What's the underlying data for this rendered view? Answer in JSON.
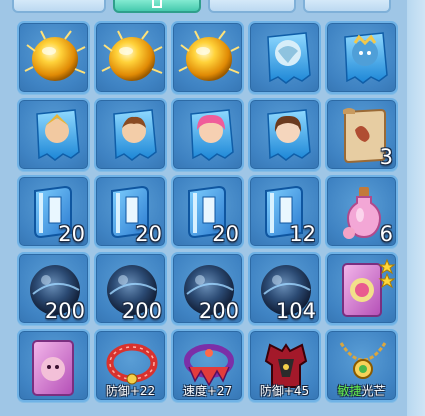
{
  "tabs": [
    {
      "name": "tab-1",
      "active": false
    },
    {
      "name": "tab-2",
      "active": true
    },
    {
      "name": "tab-3",
      "active": false
    },
    {
      "name": "tab-4",
      "active": false
    }
  ],
  "inventory": {
    "row1": [
      {
        "item": "golden-orb-icon",
        "count": ""
      },
      {
        "item": "golden-orb-icon",
        "count": ""
      },
      {
        "item": "golden-orb-icon",
        "count": ""
      },
      {
        "item": "dragon-portrait-card-icon",
        "count": ""
      },
      {
        "item": "blue-beast-portrait-card-icon",
        "count": ""
      }
    ],
    "row2": [
      {
        "item": "warrior-portrait-card-icon",
        "count": ""
      },
      {
        "item": "boy-portrait-card-icon",
        "count": ""
      },
      {
        "item": "pink-hair-portrait-card-icon",
        "count": ""
      },
      {
        "item": "maiden-portrait-card-icon",
        "count": ""
      },
      {
        "item": "scroll-icon",
        "count": "3"
      }
    ],
    "row3": [
      {
        "item": "blue-book-icon",
        "count": "20"
      },
      {
        "item": "blue-book-icon",
        "count": "20"
      },
      {
        "item": "blue-book-icon",
        "count": "20"
      },
      {
        "item": "blue-book-icon",
        "count": "12"
      },
      {
        "item": "pink-potion-icon",
        "count": "6"
      }
    ],
    "row4": [
      {
        "item": "dark-crystal-orb-icon",
        "count": "200"
      },
      {
        "item": "dark-crystal-orb-icon",
        "count": "200"
      },
      {
        "item": "dark-crystal-orb-icon",
        "count": "200"
      },
      {
        "item": "dark-crystal-orb-icon",
        "count": "104"
      },
      {
        "item": "pet-card-two-star-icon",
        "count": ""
      }
    ],
    "row5": [
      {
        "item": "pet-card-icon",
        "stat": ""
      },
      {
        "item": "red-collar-icon",
        "stat_label": "防御",
        "stat_value": "+22"
      },
      {
        "item": "demon-collar-icon",
        "stat_label": "速度",
        "stat_value": "+27"
      },
      {
        "item": "red-armor-icon",
        "stat_label": "防御",
        "stat_value": "+45"
      },
      {
        "item": "gold-necklace-icon",
        "stat_label": "敏捷",
        "stat_value": "光芒"
      }
    ]
  },
  "colors": {
    "background": "#9fc6e6",
    "slot": "#3f83c3",
    "slot_border": "#6fb2e6",
    "tab_active": "#46c9ad",
    "stat_highlight": "#62f04a"
  }
}
